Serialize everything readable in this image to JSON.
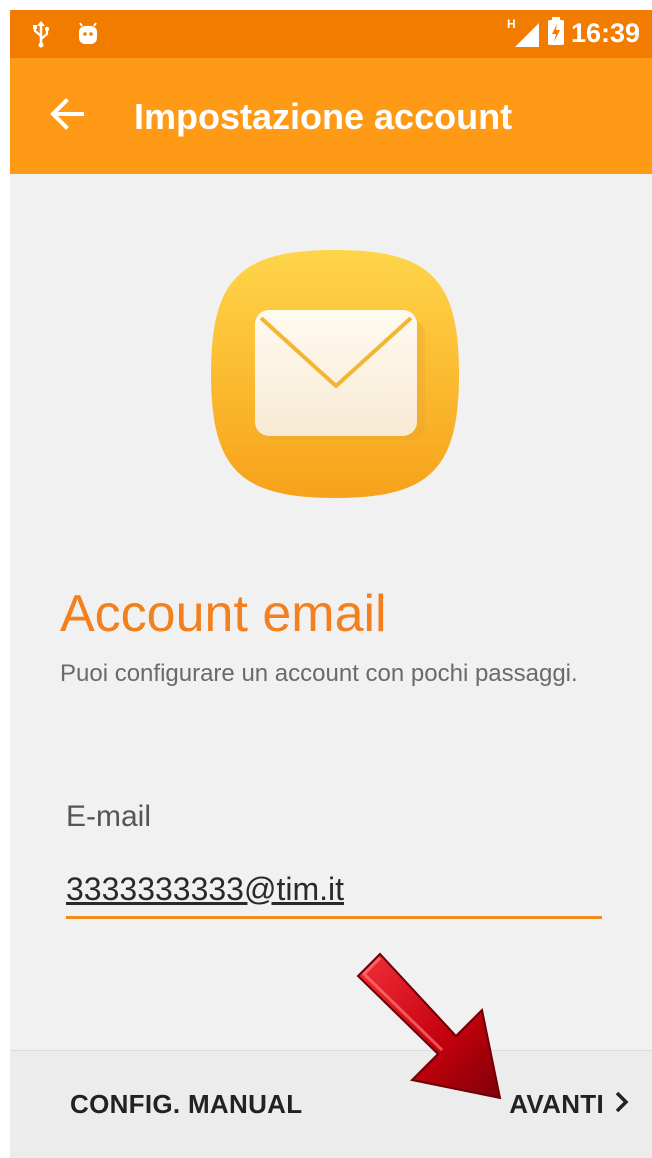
{
  "statusbar": {
    "time": "16:39",
    "network_label": "H",
    "icons": [
      "usb-icon",
      "android-debug-icon",
      "signal-icon",
      "battery-icon"
    ]
  },
  "appbar": {
    "title": "Impostazione account",
    "back_icon": "arrow-left-icon",
    "color": "#ff9a16"
  },
  "main": {
    "heading": "Account email",
    "description": "Puoi configurare un account con pochi passaggi.",
    "email": {
      "label": "E-mail",
      "value": "3333333333@tim.it"
    }
  },
  "footer": {
    "manual_label": "CONFIG. MANUAL",
    "next_label": "AVANTI"
  },
  "colors": {
    "status_bar": "#f27c00",
    "accent": "#f2801f",
    "annotation_arrow": "#c4000c"
  }
}
